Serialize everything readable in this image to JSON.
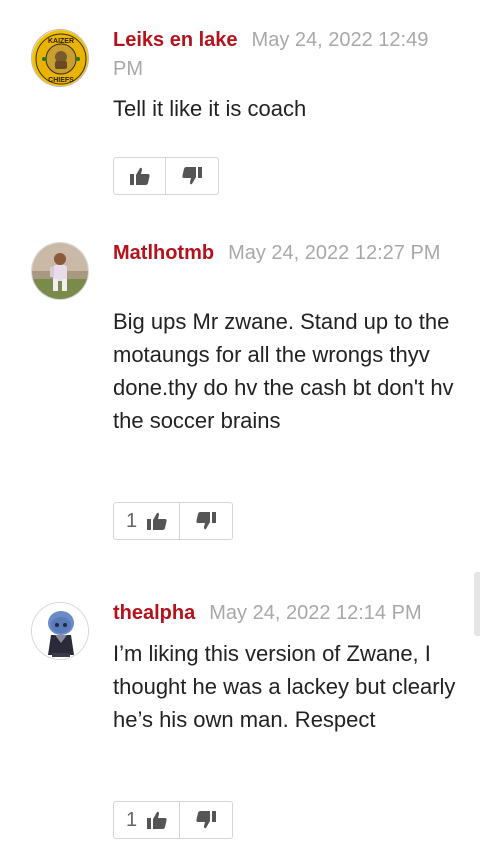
{
  "comments": [
    {
      "author": "Leiks en lake",
      "date": "May 24, 2022 12:49 PM",
      "text": "Tell it like it is coach",
      "upvotes": "",
      "avatar_icon": "kaizer-chiefs-logo-avatar",
      "avatar_text_top": "KAIZER",
      "avatar_text_bottom": "CHIEFS"
    },
    {
      "author": "Matlhotmb",
      "date": "May 24, 2022 12:27 PM",
      "text": "Big ups Mr zwane. Stand up to the motaungs for all the wrongs thyv done.thy do hv the cash bt don't hv the soccer brains",
      "upvotes": "1",
      "avatar_icon": "child-photo-avatar"
    },
    {
      "author": "thealpha",
      "date": "May 24, 2022 12:14 PM",
      "text": "I’m liking this version of Zwane, I thought he was a lackey but clearly he’s his own man. Respect",
      "upvotes": "1",
      "avatar_icon": "megamind-avatar"
    }
  ],
  "colors": {
    "author": "#b5121b",
    "date": "#a8a8a8",
    "text": "#222222",
    "vote_icon": "#555555"
  },
  "icons": {
    "upvote": "thumbs-up-icon",
    "downvote": "thumbs-down-icon"
  }
}
